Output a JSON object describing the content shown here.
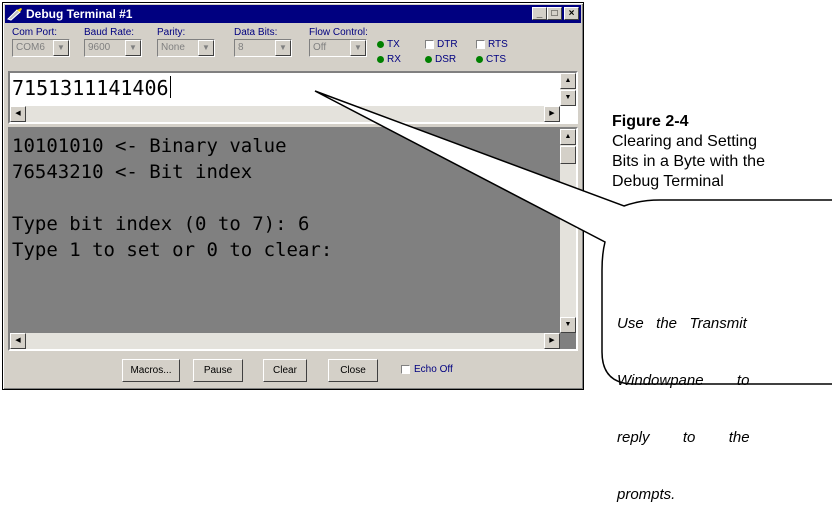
{
  "window": {
    "title": "Debug Terminal #1",
    "minimize": "_",
    "maximize": "□",
    "close": "×"
  },
  "settings": {
    "com_port": {
      "label": "Com Port:",
      "value": "COM6"
    },
    "baud_rate": {
      "label": "Baud Rate:",
      "value": "9600"
    },
    "parity": {
      "label": "Parity:",
      "value": "None"
    },
    "data_bits": {
      "label": "Data Bits:",
      "value": "8"
    },
    "flow_control": {
      "label": "Flow Control:",
      "value": "Off"
    }
  },
  "indicators": {
    "tx": "TX",
    "rx": "RX",
    "dtr": "DTR",
    "dsr": "DSR",
    "rts": "RTS",
    "cts": "CTS",
    "led_color": "#008000"
  },
  "transmit": {
    "text": "7151311141406"
  },
  "receive": {
    "lines": [
      "10101010 <- Binary value",
      "76543210 <- Bit index",
      "",
      "Type bit index (0 to 7): 6",
      "Type 1 to set or 0 to clear:"
    ]
  },
  "buttons": {
    "macros": "Macros...",
    "pause": "Pause",
    "clear": "Clear",
    "close": "Close",
    "echo_off": "Echo Off"
  },
  "caption": {
    "figure": "Figure 2-4",
    "line1": "Clearing and Setting",
    "line2": "Bits in a Byte with the",
    "line3": "Debug Terminal"
  },
  "callout": {
    "text_line1": "Use   the   Transmit",
    "text_line2": "Windowpane        to",
    "text_line3": "reply        to        the",
    "text_line4": "prompts."
  }
}
